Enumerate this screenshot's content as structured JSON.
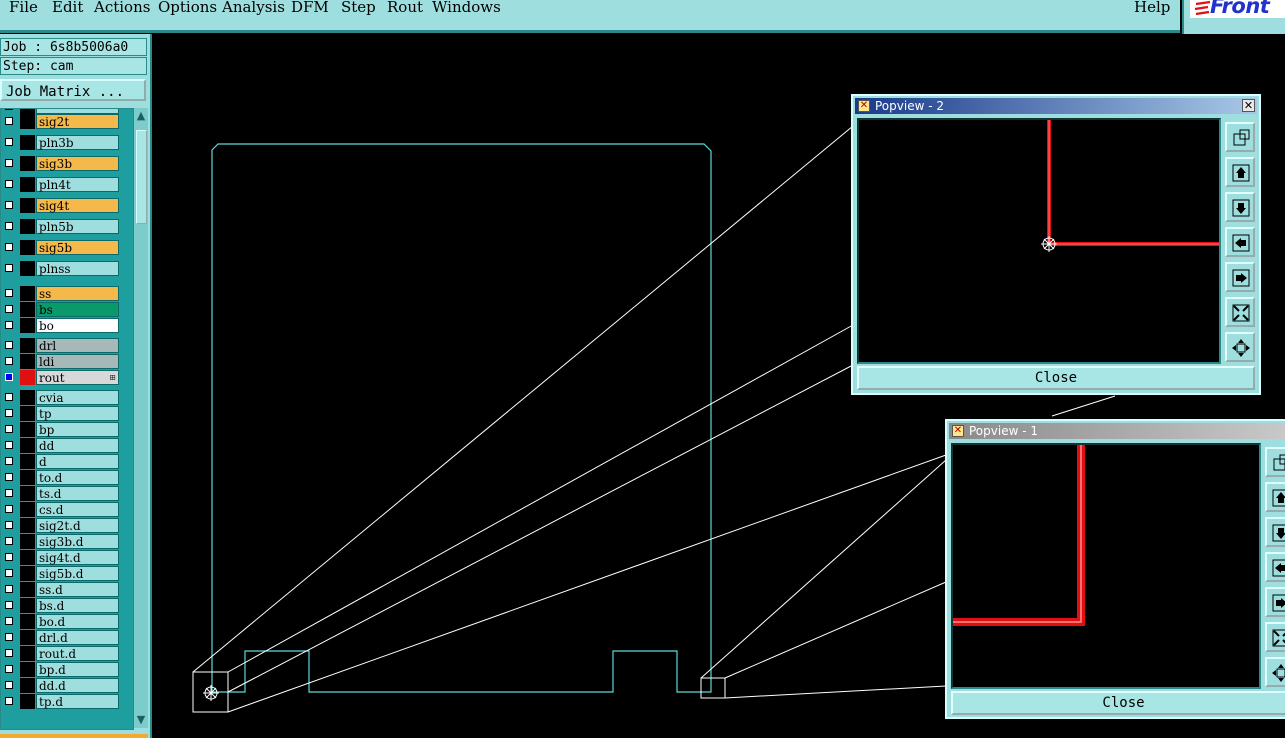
{
  "menu": {
    "items": [
      "File",
      "Edit",
      "Actions",
      "Options",
      "Analysis",
      "DFM",
      "Step",
      "Rout",
      "Windows"
    ],
    "help": "Help"
  },
  "logo": {
    "text": "Front",
    "color": "#2233cc"
  },
  "job": {
    "job_line": "Job : 6s8b5006a0",
    "step_line": "Step: cam"
  },
  "job_matrix_button": "Job Matrix ...",
  "layers": [
    {
      "name": "sig2t",
      "color": "#f5b84a"
    },
    {
      "name": "pln3b",
      "color": "#9fdede"
    },
    {
      "name": "sig3b",
      "color": "#f5b84a"
    },
    {
      "name": "pln4t",
      "color": "#9fdede"
    },
    {
      "name": "sig4t",
      "color": "#f5b84a"
    },
    {
      "name": "pln5b",
      "color": "#9fdede"
    },
    {
      "name": "sig5b",
      "color": "#f5b84a"
    },
    {
      "name": "plnss",
      "color": "#9fdede"
    },
    {
      "name": "ss",
      "color": "#f5b84a"
    },
    {
      "name": "bs",
      "color": "#0a9a6a"
    },
    {
      "name": "bo",
      "color": "#ffffff"
    },
    {
      "name": "drl",
      "color": "#a6b8b8"
    },
    {
      "name": "ldi",
      "color": "#a6b8b8"
    },
    {
      "name": "rout",
      "color": "#d8d8d8",
      "active": true,
      "swatch": "#e01010"
    },
    {
      "name": "cvia",
      "color": "#9fdede"
    },
    {
      "name": "tp",
      "color": "#9fdede"
    },
    {
      "name": "bp",
      "color": "#9fdede"
    },
    {
      "name": "dd",
      "color": "#9fdede"
    },
    {
      "name": "d",
      "color": "#9fdede"
    },
    {
      "name": "to.d",
      "color": "#9fdede"
    },
    {
      "name": "ts.d",
      "color": "#9fdede"
    },
    {
      "name": "cs.d",
      "color": "#9fdede"
    },
    {
      "name": "sig2t.d",
      "color": "#9fdede"
    },
    {
      "name": "sig3b.d",
      "color": "#9fdede"
    },
    {
      "name": "sig4t.d",
      "color": "#9fdede"
    },
    {
      "name": "sig5b.d",
      "color": "#9fdede"
    },
    {
      "name": "ss.d",
      "color": "#9fdede"
    },
    {
      "name": "bs.d",
      "color": "#9fdede"
    },
    {
      "name": "bo.d",
      "color": "#9fdede"
    },
    {
      "name": "drl.d",
      "color": "#9fdede"
    },
    {
      "name": "rout.d",
      "color": "#9fdede"
    },
    {
      "name": "bp.d",
      "color": "#9fdede"
    },
    {
      "name": "dd.d",
      "color": "#9fdede"
    },
    {
      "name": "tp.d",
      "color": "#9fdede"
    }
  ],
  "popview2": {
    "title": "Popview - 2",
    "close_label": "Close",
    "active": true
  },
  "popview1": {
    "title": "Popview - 1",
    "close_label": "Close",
    "active": false
  },
  "colors": {
    "profile": "#5fd8d8",
    "rout_path": "#e01010",
    "ui_bg": "#9fdede",
    "title_active": "#1a3a8a",
    "title_inactive": "#8a8a8a"
  }
}
